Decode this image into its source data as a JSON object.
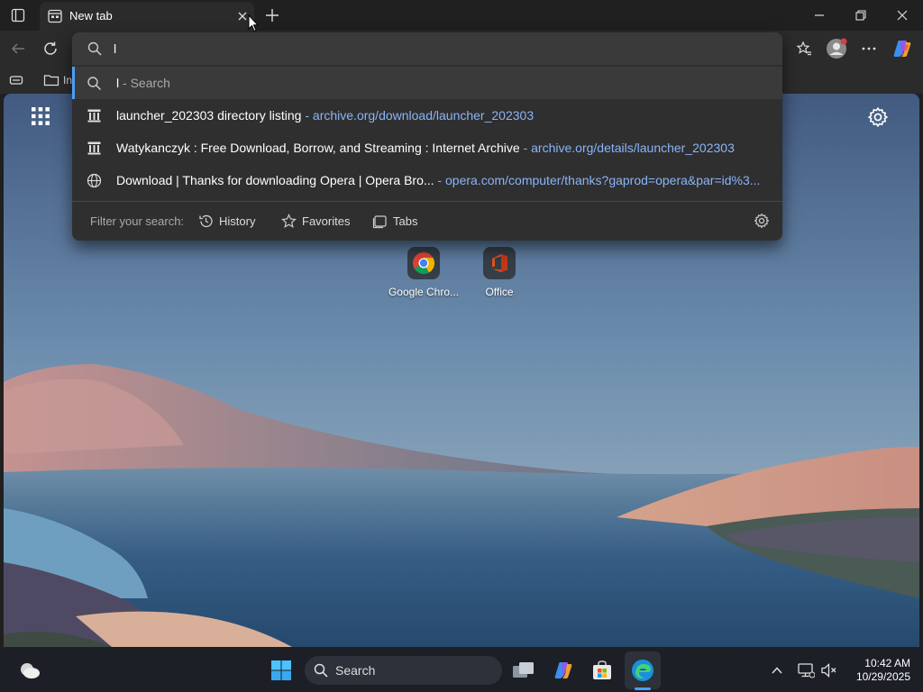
{
  "browser": {
    "tab": {
      "title": "New tab"
    },
    "favorites_bar": {
      "item1_label": "In"
    }
  },
  "address_bar": {
    "value": "l"
  },
  "suggestions": [
    {
      "icon": "search-icon",
      "text": "l",
      "suffix": " - Search",
      "url": ""
    },
    {
      "icon": "archive-icon",
      "text": "launcher_202303 directory listing",
      "sep": "  - ",
      "url": "archive.org/download/launcher_202303"
    },
    {
      "icon": "archive-icon",
      "text": "Watykanczyk : Free Download, Borrow, and Streaming : Internet Archive",
      "sep": "  - ",
      "url": "archive.org/details/launcher_202303"
    },
    {
      "icon": "globe-icon",
      "text": "Download | Thanks for downloading Opera | Opera Bro...",
      "sep": "   - ",
      "url": "opera.com/computer/thanks?gaprod=opera&par=id%3..."
    }
  ],
  "filter": {
    "label": "Filter your search:",
    "history": "History",
    "favorites": "Favorites",
    "tabs": "Tabs"
  },
  "new_tab_page": {
    "tiles": [
      {
        "label": "Google Chro...",
        "icon": "chrome-icon"
      },
      {
        "label": "Office",
        "icon": "office-icon"
      }
    ]
  },
  "taskbar": {
    "search_label": "Search",
    "time": "10:42 AM",
    "date": "10/29/2025"
  },
  "colors": {
    "accent": "#4c9ef8",
    "link": "#8ab4f8",
    "panel": "#2f2f2f"
  }
}
